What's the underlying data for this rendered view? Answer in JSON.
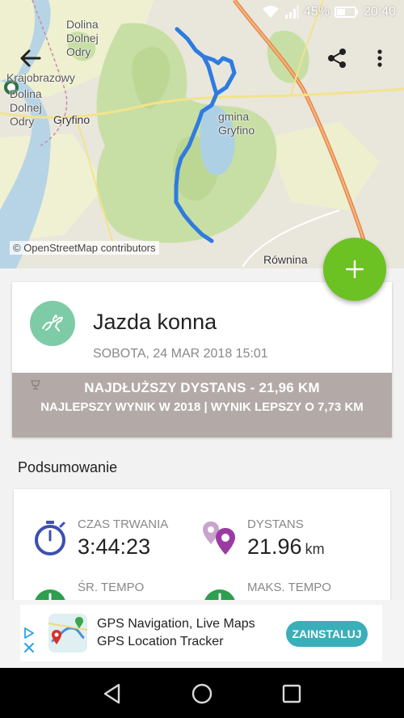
{
  "status_bar": {
    "battery": "45%",
    "time": "20:40"
  },
  "map": {
    "labels": {
      "dolina_top": "Dolina\nDolnej\nOdry",
      "krajobrazowy": "Krajobrazowy",
      "dolina_left": "Dolina\nDolnej\nOdry",
      "gryfino": "Gryfino",
      "gmina": "gmina\nGryfino",
      "rownina": "Równina"
    },
    "attribution": "© OpenStreetMap contributors",
    "route_color": "#2f7be0"
  },
  "toolbar": {
    "back_icon": "arrow-left-icon",
    "share_icon": "share-icon",
    "more_icon": "more-vert-icon"
  },
  "fab": {
    "icon": "plus-icon",
    "color": "#6cc123"
  },
  "activity": {
    "title": "Jazda konna",
    "date": "SOBOTA, 24 MAR 2018 15:01",
    "icon": "horse-riding-icon",
    "icon_color": "#7ecba7",
    "record": {
      "line1": "NAJDŁUŻSZY DYSTANS  -  21,96 KM",
      "line2": "NAJLEPSZY WYNIK W 2018  |  WYNIK LEPSZY O 7,73 KM"
    }
  },
  "summary": {
    "title": "Podsumowanie",
    "stats": [
      {
        "label": "CZAS TRWANIA",
        "value": "3:44:23",
        "unit": "",
        "icon": "stopwatch-icon",
        "color": "#3d4fb0"
      },
      {
        "label": "DYSTANS",
        "value": "21.96",
        "unit": "km",
        "icon": "map-pins-icon",
        "color": "#9c3aa3"
      },
      {
        "label": "ŚR. TEMPO",
        "value": "",
        "unit": "",
        "icon": "speed-icon",
        "color": "#2e9e4f"
      },
      {
        "label": "MAKS. TEMPO",
        "value": "",
        "unit": "",
        "icon": "speed-icon",
        "color": "#2e9e4f"
      }
    ]
  },
  "ad": {
    "title_line1": "GPS Navigation, Live Maps",
    "title_line2": "GPS Location Tracker",
    "button": "ZAINSTALUJ",
    "button_color": "#3aafb9"
  },
  "navbar": {
    "back": "nav-back-icon",
    "home": "nav-home-icon",
    "recents": "nav-recents-icon"
  }
}
